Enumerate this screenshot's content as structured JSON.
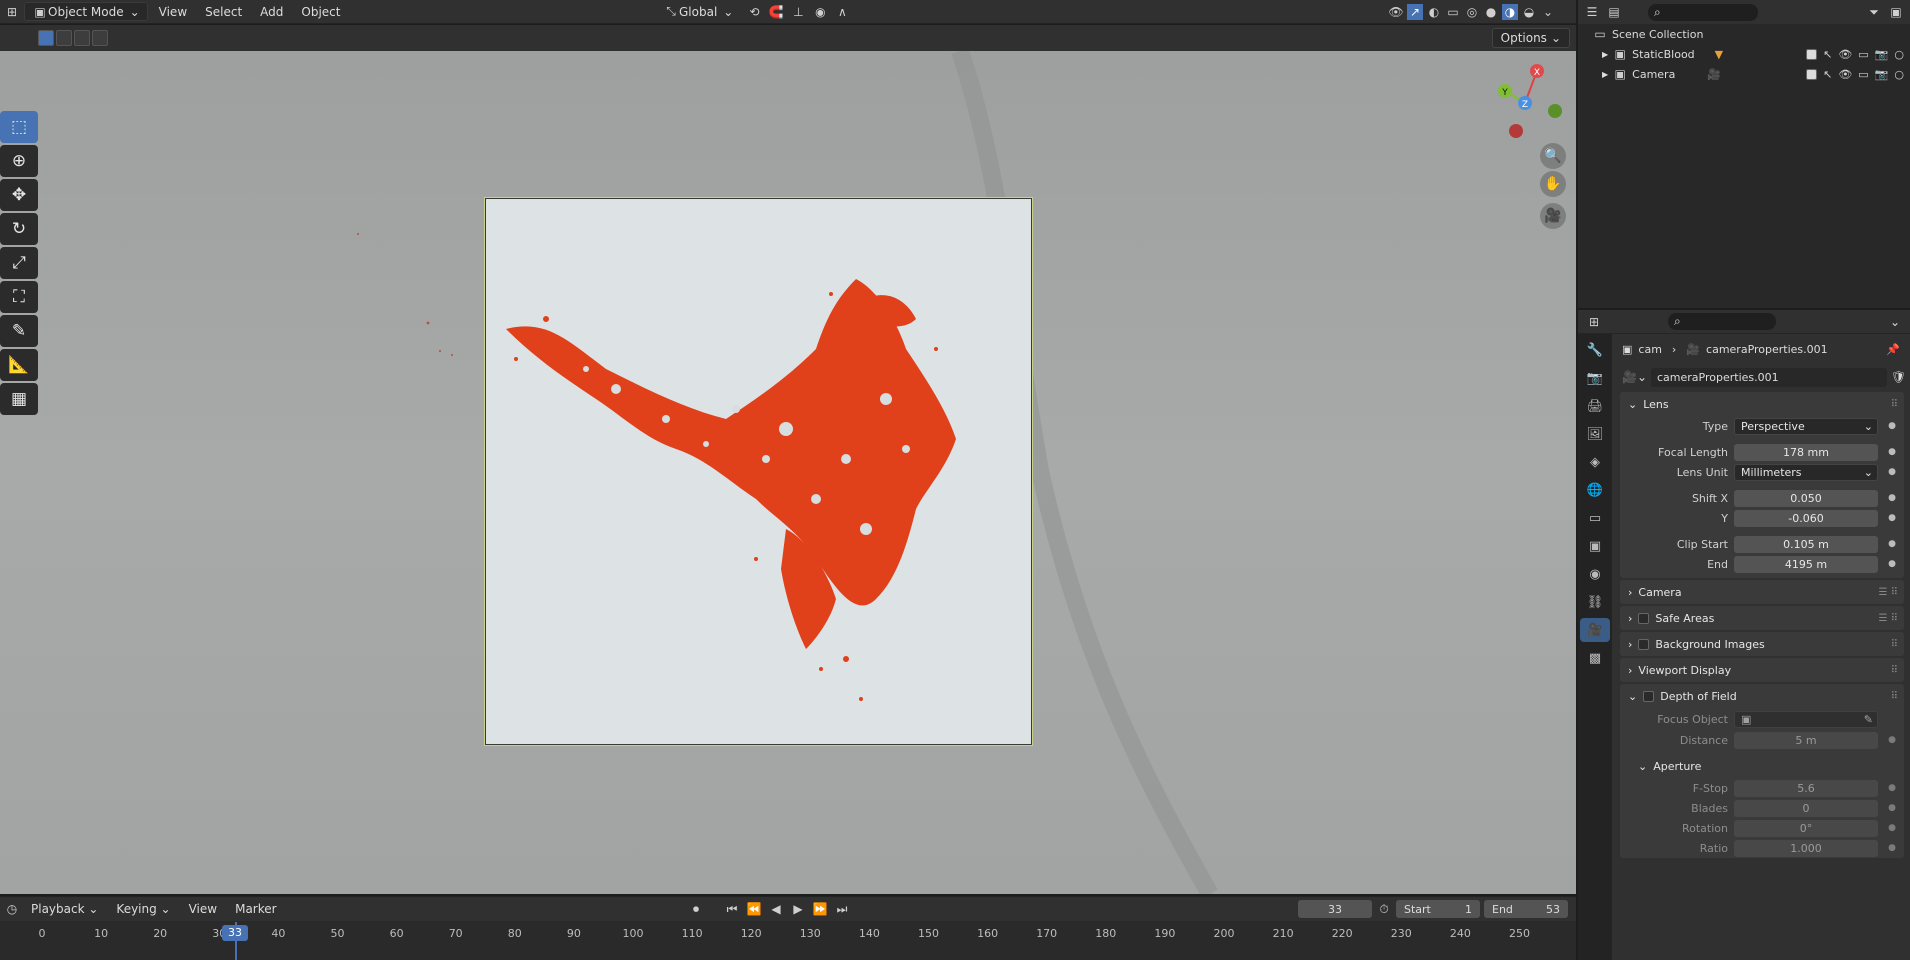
{
  "header": {
    "mode_label": "Object Mode",
    "menus": [
      "View",
      "Select",
      "Add",
      "Object"
    ],
    "transform_label": "Global"
  },
  "toolbar": {
    "options_label": "Options"
  },
  "timeline": {
    "menus": [
      "Playback",
      "Keying",
      "View",
      "Marker"
    ],
    "current_frame": "33",
    "start_label": "Start",
    "start_value": "1",
    "end_label": "End",
    "end_value": "53",
    "ticks": [
      "0",
      "10",
      "20",
      "30",
      "40",
      "50",
      "60",
      "70",
      "80",
      "90",
      "100",
      "110",
      "120",
      "130",
      "140",
      "150",
      "160",
      "170",
      "180",
      "190",
      "200",
      "210",
      "220",
      "230",
      "240",
      "250"
    ]
  },
  "outliner": {
    "root": "Scene Collection",
    "items": [
      {
        "label": "StaticBlood"
      },
      {
        "label": "Camera"
      }
    ]
  },
  "properties": {
    "breadcrumb_obj": "cam",
    "breadcrumb_data": "cameraProperties.001",
    "datablock_name": "cameraProperties.001",
    "lens": {
      "title": "Lens",
      "type_label": "Type",
      "type_value": "Perspective",
      "focal_label": "Focal Length",
      "focal_value": "178 mm",
      "lens_unit_label": "Lens Unit",
      "lens_unit_value": "Millimeters",
      "shiftx_label": "Shift X",
      "shiftx_value": "0.050",
      "shifty_label": "Y",
      "shifty_value": "-0.060",
      "clipstart_label": "Clip Start",
      "clipstart_value": "0.105 m",
      "clipend_label": "End",
      "clipend_value": "4195 m"
    },
    "panels": {
      "camera": "Camera",
      "safe_areas": "Safe Areas",
      "background_images": "Background Images",
      "viewport_display": "Viewport Display",
      "dof": "Depth of Field"
    },
    "dof": {
      "focus_object_label": "Focus Object",
      "distance_label": "Distance",
      "distance_value": "5 m",
      "aperture_title": "Aperture",
      "fstop_label": "F-Stop",
      "fstop_value": "5.6",
      "blades_label": "Blades",
      "blades_value": "0",
      "rotation_label": "Rotation",
      "rotation_value": "0°",
      "ratio_label": "Ratio",
      "ratio_value": "1.000"
    }
  },
  "gizmo": {
    "x": "X",
    "y": "Y",
    "z": "Z"
  },
  "colors": {
    "accent": "#4772b3",
    "blood": "#e0401a"
  }
}
